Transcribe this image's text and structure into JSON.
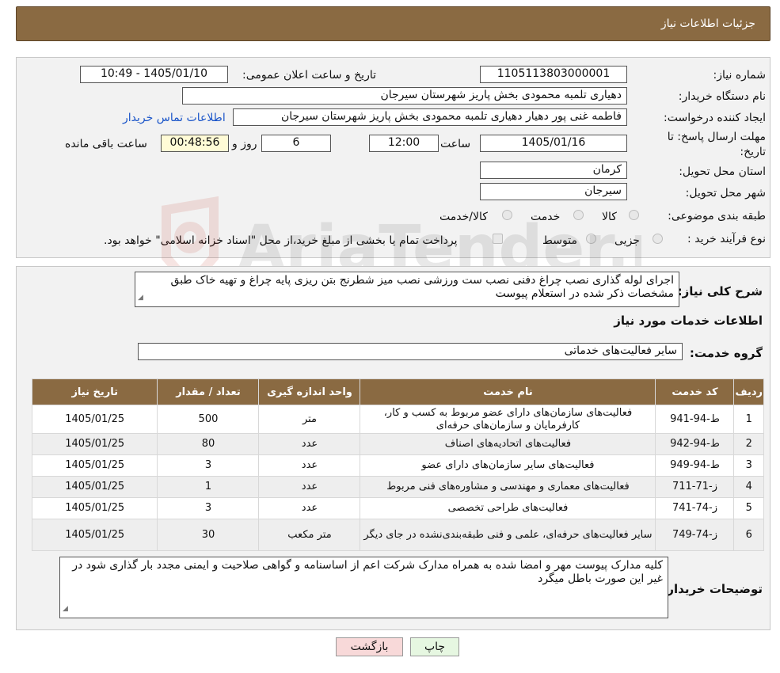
{
  "header": {
    "title": "جزئیات اطلاعات نیاز"
  },
  "form": {
    "need_number_label": "شماره نیاز:",
    "need_number": "1105113803000001",
    "announce_label": "تاریخ و ساعت اعلان عمومی:",
    "announce_value": "1405/01/10 - 10:49",
    "buyer_org_label": "نام دستگاه خریدار:",
    "buyer_org": "دهیاری تلمبه محمودی بخش پاریز شهرستان سیرجان",
    "creator_label": "ایجاد کننده درخواست:",
    "creator": "فاطمه غنی پور دهیار دهیاری تلمبه محمودی بخش پاریز شهرستان سیرجان",
    "contact_link": "اطلاعات تماس خریدار",
    "deadline_label_1": "مهلت ارسال پاسخ: تا",
    "deadline_label_2": "تاریخ:",
    "deadline_date": "1405/01/16",
    "time_label": "ساعت",
    "deadline_time": "12:00",
    "days_value": "6",
    "days_label": "روز و",
    "remaining_value": "00:48:56",
    "remaining_label": "ساعت باقی مانده",
    "province_label": "استان محل تحویل:",
    "province": "کرمان",
    "city_label": "شهر محل تحویل:",
    "city": "سیرجان",
    "category_label": "طبقه بندی موضوعی:",
    "category_options": [
      "کالا",
      "خدمت",
      "کالا/خدمت"
    ],
    "process_label": "نوع فرآیند خرید :",
    "process_options": [
      "جزیی",
      "متوسط"
    ],
    "process_note": "پرداخت تمام یا بخشی از مبلغ خرید،از محل \"اسناد خزانه اسلامی\" خواهد بود."
  },
  "description": {
    "label": "شرح کلی نیاز:",
    "text": "اجرای لوله گذاری نصب چراغ دفنی نصب ست ورزشی نصب میز شطرنج بتن ریزی پایه چراغ و تهیه خاک طبق مشخصات ذکر شده در استعلام پیوست"
  },
  "services": {
    "section_title": "اطلاعات خدمات مورد نیاز",
    "group_label": "گروه خدمت:",
    "group_value": "سایر فعالیت‌های خدماتی",
    "columns": [
      "ردیف",
      "کد خدمت",
      "نام خدمت",
      "واحد اندازه گیری",
      "تعداد / مقدار",
      "تاریخ نیاز"
    ],
    "rows": [
      [
        "1",
        "ط-94-941",
        "فعالیت‌های سازمان‌های دارای عضو مربوط به کسب و کار، کارفرمایان و سازمان‌های حرفه‌ای",
        "متر",
        "500",
        "1405/01/25"
      ],
      [
        "2",
        "ط-94-942",
        "فعالیت‌های اتحادیه‌های اصناف",
        "عدد",
        "80",
        "1405/01/25"
      ],
      [
        "3",
        "ط-94-949",
        "فعالیت‌های سایر سازمان‌های دارای عضو",
        "عدد",
        "3",
        "1405/01/25"
      ],
      [
        "4",
        "ز-71-711",
        "فعالیت‌های معماری و مهندسی و مشاوره‌های فنی مربوط",
        "عدد",
        "1",
        "1405/01/25"
      ],
      [
        "5",
        "ز-74-741",
        "فعالیت‌های طراحی تخصصی",
        "عدد",
        "3",
        "1405/01/25"
      ],
      [
        "6",
        "ز-74-749",
        "سایر فعالیت‌های حرفه‌ای، علمی و فنی طبقه‌بندی‌نشده در جای دیگر",
        "متر مکعب",
        "30",
        "1405/01/25"
      ]
    ]
  },
  "buyer_notes": {
    "label": "توضیحات خریدار:",
    "text": "کلیه مدارک پیوست مهر و امضا شده به همراه مدارک شرکت اعم از اساسنامه و گواهی صلاحیت و ایمنی مجدد بار گذاری شود در غیر این صورت باطل میگرد"
  },
  "buttons": {
    "print": "چاپ",
    "back": "بازگشت"
  },
  "watermark": {
    "text": "AriaTender.neT"
  },
  "colors": {
    "header": "#8a6a42",
    "link": "#1a55c9",
    "back_button": "#f8d9d9",
    "print_button": "#e6f7e1"
  }
}
